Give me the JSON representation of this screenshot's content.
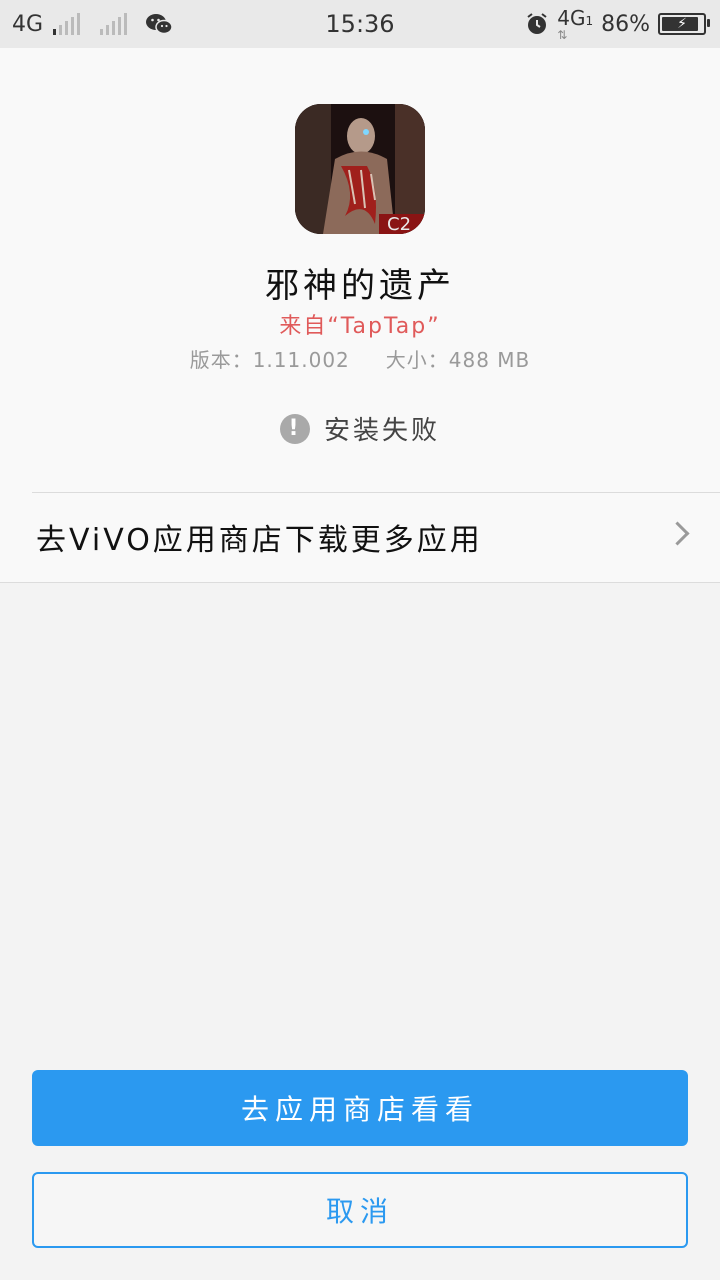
{
  "status_bar": {
    "network_left": "4G",
    "time": "15:36",
    "network_right": "4G",
    "sim_index": "1",
    "battery": "86%",
    "icons": [
      "signal-icon",
      "wechat-icon",
      "alarm-icon",
      "battery-icon"
    ]
  },
  "app": {
    "name": "邪神的遗产",
    "source": "来自“TapTap”",
    "version": "版本：1.11.002",
    "size": "大小：488 MB",
    "install_status": "安装失败",
    "icon_overlay_text": "C2"
  },
  "store_link": {
    "label": "去ViVO应用商店下载更多应用"
  },
  "buttons": {
    "primary": "去应用商店看看",
    "secondary": "取消"
  },
  "colors": {
    "accent": "#2b99f0",
    "source_text": "#e05a5a",
    "background": "#f3f3f3"
  }
}
